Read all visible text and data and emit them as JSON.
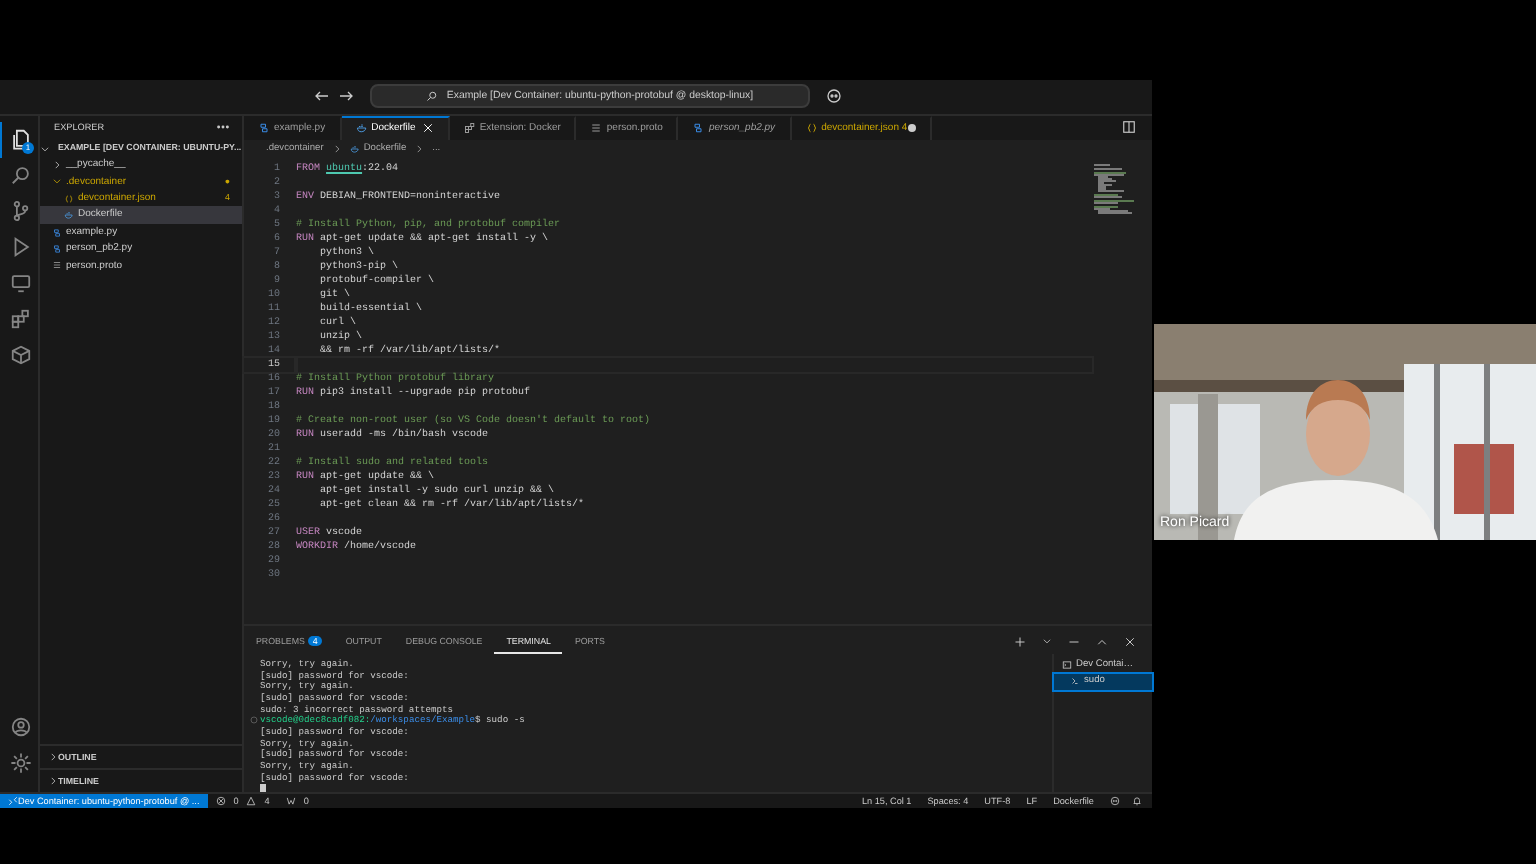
{
  "window": {
    "title": "Example [Dev Container: ubuntu-python-protobuf @ desktop-linux]"
  },
  "activity_bar": [
    {
      "kind": "explorer",
      "selected": true,
      "badge": "1"
    },
    {
      "kind": "search",
      "selected": false
    },
    {
      "kind": "source-control",
      "selected": false
    },
    {
      "kind": "run",
      "selected": false
    },
    {
      "kind": "remote",
      "selected": false
    },
    {
      "kind": "extensions",
      "selected": false
    },
    {
      "kind": "docker",
      "selected": false
    },
    {
      "kind": "account",
      "selected": false
    },
    {
      "kind": "settings",
      "selected": false
    }
  ],
  "sidebar": {
    "title": "EXPLORER",
    "root": "EXAMPLE [DEV CONTAINER: UBUNTU-PY...",
    "items": [
      {
        "label": "__pycache__",
        "kind": "folder",
        "expanded": false,
        "selected": false,
        "warning": false
      },
      {
        "label": ".devcontainer",
        "kind": "folder",
        "expanded": true,
        "selected": false,
        "warning": true,
        "badge": "●",
        "children": [
          {
            "label": "devcontainer.json",
            "kind": "json",
            "selected": false,
            "warning": true,
            "badge": "4"
          },
          {
            "label": "Dockerfile",
            "kind": "docker",
            "selected": true,
            "warning": false
          }
        ]
      },
      {
        "label": "example.py",
        "kind": "python",
        "selected": false,
        "warning": false
      },
      {
        "label": "person_pb2.py",
        "kind": "python",
        "selected": false,
        "warning": false
      },
      {
        "label": "person.proto",
        "kind": "proto",
        "selected": false,
        "warning": false
      }
    ],
    "sections": [
      {
        "label": "OUTLINE",
        "expanded": false
      },
      {
        "label": "TIMELINE",
        "expanded": false
      }
    ]
  },
  "tabs": [
    {
      "label": "example.py",
      "kind": "python",
      "selected": false,
      "preview": false,
      "warning": false,
      "modified": false
    },
    {
      "label": "Dockerfile",
      "kind": "docker",
      "selected": true,
      "preview": false,
      "warning": false,
      "modified": false
    },
    {
      "label": "Extension: Docker",
      "kind": "extension",
      "selected": false,
      "preview": false,
      "warning": false,
      "modified": false
    },
    {
      "label": "person.proto",
      "kind": "proto",
      "selected": false,
      "preview": false,
      "warning": false,
      "modified": false
    },
    {
      "label": "person_pb2.py",
      "kind": "python",
      "selected": false,
      "preview": true,
      "warning": false,
      "modified": false
    },
    {
      "label": "devcontainer.json",
      "kind": "json",
      "selected": false,
      "preview": false,
      "warning": true,
      "badge": "4",
      "modified": true
    }
  ],
  "breadcrumb": [
    {
      "label": ".devcontainer",
      "kind": "folder"
    },
    {
      "label": "Dockerfile",
      "kind": "docker"
    },
    {
      "label": "...",
      "kind": "more"
    }
  ],
  "code": [
    {
      "n": "1",
      "current": false,
      "tokens": [
        {
          "kind": "keyword",
          "text": "FROM"
        },
        {
          "kind": "link",
          "text": "ubuntu"
        },
        {
          "kind": "plain",
          "text": ":22.04"
        }
      ]
    },
    {
      "n": "2",
      "current": false
    },
    {
      "n": "3",
      "current": false,
      "tokens": [
        {
          "kind": "keyword",
          "text": "ENV"
        },
        {
          "kind": "plain",
          "text": " DEBIAN_FRONTEND=noninteractive"
        }
      ]
    },
    {
      "n": "4",
      "current": false
    },
    {
      "n": "5",
      "current": false,
      "tokens": [
        {
          "kind": "comment",
          "text": "# Install Python, pip, and protobuf compiler"
        }
      ]
    },
    {
      "n": "6",
      "current": false,
      "tokens": [
        {
          "kind": "keyword",
          "text": "RUN"
        },
        {
          "kind": "plain",
          "text": " apt-get update && apt-get install -y \\"
        }
      ]
    },
    {
      "n": "7",
      "current": false,
      "tokens": [
        {
          "kind": "plain",
          "text": "    python3 \\"
        }
      ]
    },
    {
      "n": "8",
      "current": false,
      "tokens": [
        {
          "kind": "plain",
          "text": "    python3-pip \\"
        }
      ]
    },
    {
      "n": "9",
      "current": false,
      "tokens": [
        {
          "kind": "plain",
          "text": "    protobuf-compiler \\"
        }
      ]
    },
    {
      "n": "10",
      "current": false,
      "tokens": [
        {
          "kind": "plain",
          "text": "    git \\"
        }
      ]
    },
    {
      "n": "11",
      "current": false,
      "tokens": [
        {
          "kind": "plain",
          "text": "    build-essential \\"
        }
      ]
    },
    {
      "n": "12",
      "current": false,
      "tokens": [
        {
          "kind": "plain",
          "text": "    curl \\"
        }
      ]
    },
    {
      "n": "13",
      "current": false,
      "tokens": [
        {
          "kind": "plain",
          "text": "    unzip \\"
        }
      ]
    },
    {
      "n": "14",
      "current": false,
      "tokens": [
        {
          "kind": "plain",
          "text": "    && rm -rf /var/lib/apt/lists/*"
        }
      ]
    },
    {
      "n": "15",
      "current": true
    },
    {
      "n": "16",
      "current": false,
      "tokens": [
        {
          "kind": "comment",
          "text": "# Install Python protobuf library"
        }
      ]
    },
    {
      "n": "17",
      "current": false,
      "tokens": [
        {
          "kind": "keyword",
          "text": "RUN"
        },
        {
          "kind": "plain",
          "text": " pip3 install --upgrade pip protobuf"
        }
      ]
    },
    {
      "n": "18",
      "current": false
    },
    {
      "n": "19",
      "current": false,
      "tokens": [
        {
          "kind": "comment",
          "text": "# Create non-root user (so VS Code doesn't default to root)"
        }
      ]
    },
    {
      "n": "20",
      "current": false,
      "tokens": [
        {
          "kind": "keyword",
          "text": "RUN"
        },
        {
          "kind": "plain",
          "text": " useradd -ms /bin/bash vscode"
        }
      ]
    },
    {
      "n": "21",
      "current": false
    },
    {
      "n": "22",
      "current": false,
      "tokens": [
        {
          "kind": "comment",
          "text": "# Install sudo and related tools"
        }
      ]
    },
    {
      "n": "23",
      "current": false,
      "tokens": [
        {
          "kind": "keyword",
          "text": "RUN"
        },
        {
          "kind": "plain",
          "text": " apt-get update && \\"
        }
      ]
    },
    {
      "n": "24",
      "current": false,
      "tokens": [
        {
          "kind": "plain",
          "text": "    apt-get install -y sudo curl unzip && \\"
        }
      ]
    },
    {
      "n": "25",
      "current": false,
      "tokens": [
        {
          "kind": "plain",
          "text": "    apt-get clean && rm -rf /var/lib/apt/lists/*"
        }
      ]
    },
    {
      "n": "26",
      "current": false
    },
    {
      "n": "27",
      "current": false,
      "tokens": [
        {
          "kind": "keyword",
          "text": "USER"
        },
        {
          "kind": "plain",
          "text": " vscode"
        }
      ]
    },
    {
      "n": "28",
      "current": false,
      "tokens": [
        {
          "kind": "keyword",
          "text": "WORKDIR"
        },
        {
          "kind": "plain",
          "text": " /home/vscode"
        }
      ]
    },
    {
      "n": "29",
      "current": false
    },
    {
      "n": "30",
      "current": false
    }
  ],
  "panel": {
    "tabs": [
      {
        "label": "PROBLEMS",
        "selected": false,
        "badge": "4"
      },
      {
        "label": "OUTPUT",
        "selected": false
      },
      {
        "label": "DEBUG CONSOLE",
        "selected": false
      },
      {
        "label": "TERMINAL",
        "selected": true
      },
      {
        "label": "PORTS",
        "selected": false
      }
    ],
    "terminal": [
      {
        "kind": "output",
        "text": "Sorry, try again."
      },
      {
        "kind": "output",
        "text": "[sudo] password for vscode:"
      },
      {
        "kind": "output",
        "text": "Sorry, try again."
      },
      {
        "kind": "output",
        "text": "[sudo] password for vscode:"
      },
      {
        "kind": "output",
        "text": "sudo: 3 incorrect password attempts"
      },
      {
        "kind": "prompt",
        "user": "vscode@0dec8cadf082:",
        "path": "/workspaces/Example",
        "command": "$ sudo -s"
      },
      {
        "kind": "output",
        "text": "[sudo] password for vscode:"
      },
      {
        "kind": "output",
        "text": "Sorry, try again."
      },
      {
        "kind": "output",
        "text": "[sudo] password for vscode:"
      },
      {
        "kind": "output",
        "text": "Sorry, try again."
      },
      {
        "kind": "output",
        "text": "[sudo] password for vscode:"
      },
      {
        "kind": "cursor"
      }
    ],
    "terminals": [
      {
        "label": "Dev Contai…",
        "kind": "container",
        "selected": false
      },
      {
        "label": "sudo",
        "kind": "shell",
        "selected": true
      }
    ]
  },
  "status_bar": {
    "remote": "Dev Container: ubuntu-python-protobuf @ ...",
    "errors": "0",
    "warnings": "4",
    "ports": "0",
    "right": [
      "Ln 15, Col 1",
      "Spaces: 4",
      "UTF-8",
      "LF",
      "Dockerfile"
    ]
  },
  "webcam": {
    "name": "Ron Picard"
  }
}
